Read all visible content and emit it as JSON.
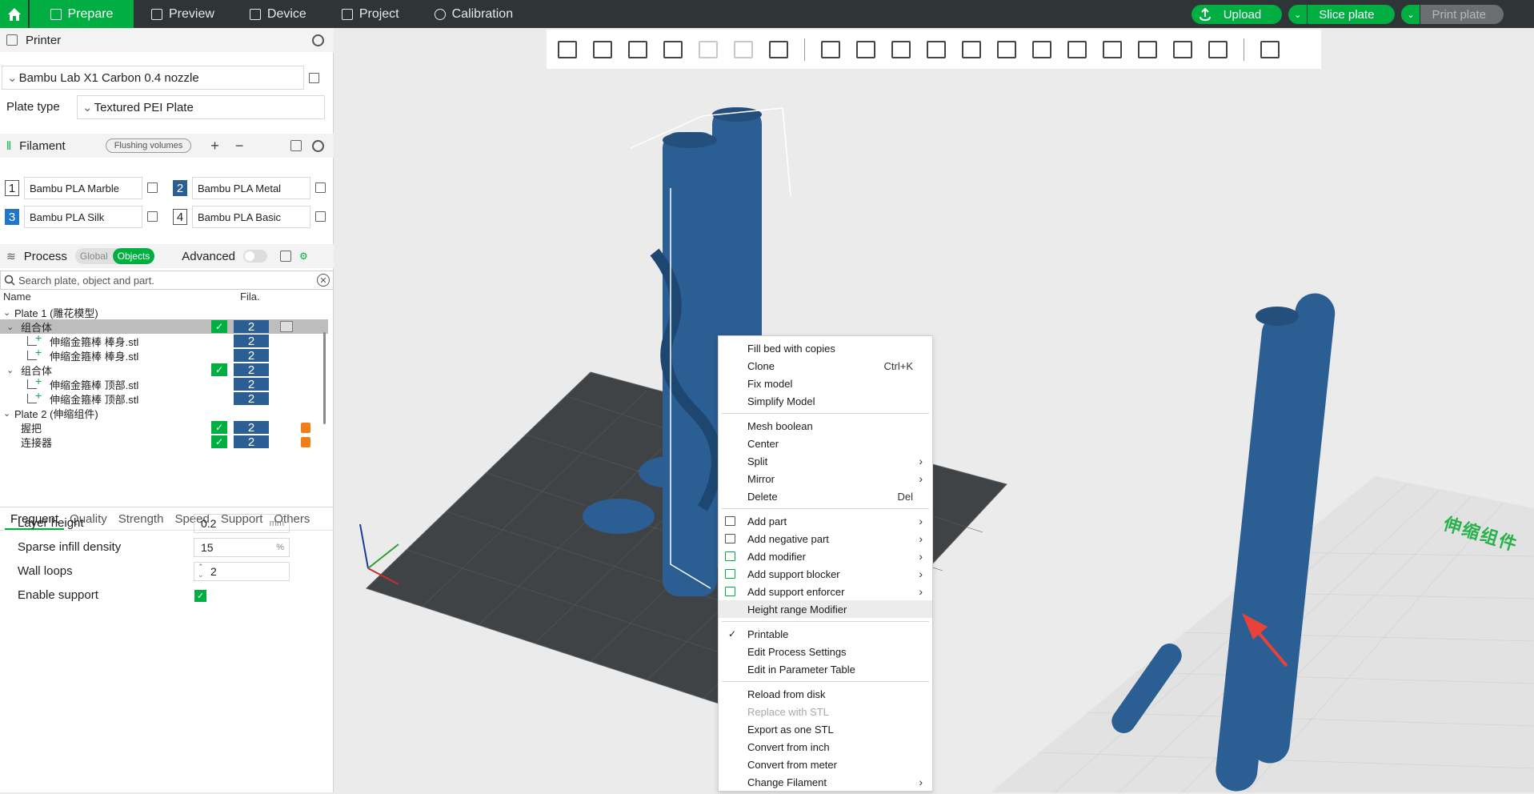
{
  "topbar": {
    "tabs": [
      {
        "label": "Prepare",
        "icon": "cube-icon"
      },
      {
        "label": "Preview",
        "icon": "layers-icon"
      },
      {
        "label": "Device",
        "icon": "device-icon"
      },
      {
        "label": "Project",
        "icon": "project-icon"
      },
      {
        "label": "Calibration",
        "icon": "calibration-icon"
      }
    ],
    "upload": "Upload",
    "slice": "Slice plate",
    "print": "Print plate"
  },
  "printer": {
    "title": "Printer",
    "name": "Bambu Lab X1 Carbon 0.4 nozzle",
    "plate_type_label": "Plate type",
    "plate_type": "Textured PEI Plate"
  },
  "filament": {
    "title": "Filament",
    "flushing": "Flushing volumes",
    "items": [
      {
        "num": "1",
        "name": "Bambu PLA Marble"
      },
      {
        "num": "2",
        "name": "Bambu PLA Metal"
      },
      {
        "num": "3",
        "name": "Bambu PLA Silk"
      },
      {
        "num": "4",
        "name": "Bambu PLA Basic"
      }
    ]
  },
  "process": {
    "title": "Process",
    "global": "Global",
    "objects": "Objects",
    "advanced": "Advanced",
    "search_placeholder": "Search plate, object and part.",
    "col_name": "Name",
    "col_fila": "Fila.",
    "tree": [
      {
        "label": "Plate 1 (雕花模型)",
        "indent": 0,
        "arrow": "⌄"
      },
      {
        "label": "组合体",
        "indent": 1,
        "arrow": "⌄",
        "check": true,
        "fil": "2",
        "selected": true
      },
      {
        "label": "伸缩金箍棒 棒身.stl",
        "indent": 2,
        "fil": "2"
      },
      {
        "label": "伸缩金箍棒 棒身.stl",
        "indent": 2,
        "fil": "2"
      },
      {
        "label": "组合体",
        "indent": 1,
        "arrow": "⌄",
        "check": true,
        "fil": "2"
      },
      {
        "label": "伸缩金箍棒 顶部.stl",
        "indent": 2,
        "fil": "2"
      },
      {
        "label": "伸缩金箍棒 顶部.stl",
        "indent": 2,
        "fil": "2"
      },
      {
        "label": "Plate 2 (伸缩组件)",
        "indent": 0,
        "arrow": "⌄"
      },
      {
        "label": "握把",
        "indent": 1,
        "check": true,
        "fil": "2",
        "lock": true
      },
      {
        "label": "连接器",
        "indent": 1,
        "check": true,
        "fil": "2",
        "lock": true
      }
    ],
    "tabs": [
      "Frequent",
      "Quality",
      "Strength",
      "Speed",
      "Support",
      "Others"
    ],
    "params": {
      "layer_height_label": "Layer height",
      "layer_height": "0.2",
      "layer_height_unit": "mm",
      "infill_label": "Sparse infill density",
      "infill": "15",
      "infill_unit": "%",
      "walls_label": "Wall loops",
      "walls": "2",
      "support_label": "Enable support"
    }
  },
  "context_menu": {
    "fill_bed": "Fill bed with copies",
    "clone": "Clone",
    "clone_sc": "Ctrl+K",
    "fix": "Fix model",
    "simplify": "Simplify Model",
    "mesh_boolean": "Mesh boolean",
    "center": "Center",
    "split": "Split",
    "mirror": "Mirror",
    "delete": "Delete",
    "delete_sc": "Del",
    "add_part": "Add part",
    "add_negative": "Add negative part",
    "add_modifier": "Add modifier",
    "add_blocker": "Add support blocker",
    "add_enforcer": "Add support enforcer",
    "height_range": "Height range Modifier",
    "printable": "Printable",
    "edit_process": "Edit Process Settings",
    "edit_param_table": "Edit in Parameter Table",
    "reload": "Reload from disk",
    "replace": "Replace with STL",
    "export_stl": "Export as one STL",
    "convert_inch": "Convert from inch",
    "convert_meter": "Convert from meter",
    "change_filament": "Change Filament"
  },
  "bed": {
    "plate2_label": "伸缩组件"
  },
  "colors": {
    "accent": "#00ae42",
    "topbar": "#2f3437",
    "model": "#2b5e93"
  }
}
